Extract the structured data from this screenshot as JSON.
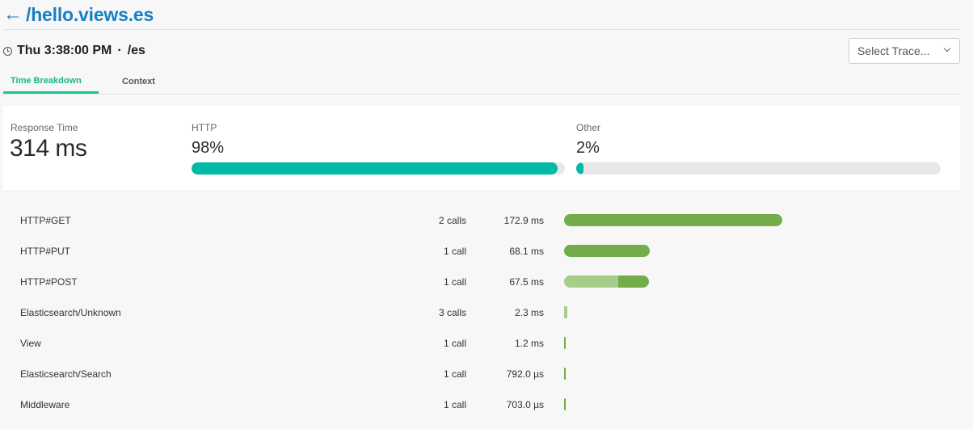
{
  "header": {
    "back_icon": "left-arrow-icon",
    "title": "/hello.views.es",
    "timestamp": "Thu 3:38:00 PM",
    "separator": "·",
    "path": "/es",
    "select_trace_placeholder": "Select Trace..."
  },
  "tabs": [
    {
      "label": "Time Breakdown",
      "active": true
    },
    {
      "label": "Context",
      "active": false
    }
  ],
  "summary": {
    "response_time_label": "Response Time",
    "response_time_value": "314 ms",
    "http_label": "HTTP",
    "http_value": "98%",
    "http_fraction": 0.98,
    "other_label": "Other",
    "other_value": "2%",
    "other_fraction": 0.02,
    "bar_color": "#00b9a7"
  },
  "colors": {
    "accent_green": "#15c78f",
    "bar_dark": "#72ad4a",
    "bar_light": "#a7cd8b",
    "title_blue": "#1a7fc1"
  },
  "breakdown": [
    {
      "name": "HTTP#GET",
      "calls": "2 calls",
      "duration": "172.9 ms",
      "ms": 172.9,
      "light_ms": 0
    },
    {
      "name": "HTTP#PUT",
      "calls": "1 call",
      "duration": "68.1 ms",
      "ms": 68.1,
      "light_ms": 0
    },
    {
      "name": "HTTP#POST",
      "calls": "1 call",
      "duration": "67.5 ms",
      "ms": 67.5,
      "light_ms": 43.0
    },
    {
      "name": "Elasticsearch/Unknown",
      "calls": "3 calls",
      "duration": "2.3 ms",
      "ms": 2.3,
      "light_ms": 0
    },
    {
      "name": "View",
      "calls": "1 call",
      "duration": "1.2 ms",
      "ms": 1.2,
      "light_ms": 0
    },
    {
      "name": "Elasticsearch/Search",
      "calls": "1 call",
      "duration": "792.0 µs",
      "ms": 0.792,
      "light_ms": 0
    },
    {
      "name": "Middleware",
      "calls": "1 call",
      "duration": "703.0 µs",
      "ms": 0.703,
      "light_ms": 0
    }
  ]
}
